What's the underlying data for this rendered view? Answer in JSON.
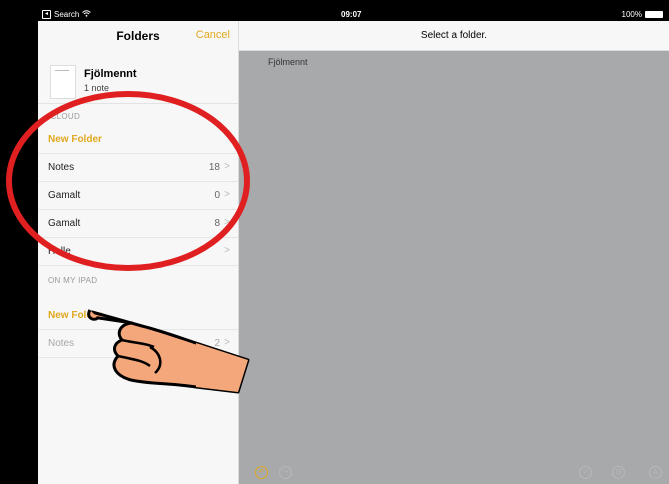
{
  "status_bar": {
    "back_label": "Search",
    "time": "09:07",
    "battery": "100%"
  },
  "sidebar": {
    "title": "Folders",
    "cancel": "Cancel",
    "note": {
      "title": "Fjölmennt",
      "count": "1 note"
    },
    "icloud_label": "ICLOUD",
    "icloud_rows": [
      {
        "label": "New Folder",
        "count": ""
      },
      {
        "label": "Notes",
        "count": "18"
      },
      {
        "label": "Gamalt",
        "count": "0"
      },
      {
        "label": "Gamalt",
        "count": "8"
      },
      {
        "label": "Helle",
        "count": ""
      }
    ],
    "ipad_label": "ON MY IPAD",
    "ipad_rows": [
      {
        "label": "New Folder",
        "count": ""
      },
      {
        "label": "Notes",
        "count": "2"
      }
    ]
  },
  "content": {
    "title": "Select a folder.",
    "breadcrumb": "Fjölmennt"
  },
  "colors": {
    "accent": "#e0a81e",
    "annotation_circle": "#e02020",
    "hand": "#f4a77a"
  }
}
